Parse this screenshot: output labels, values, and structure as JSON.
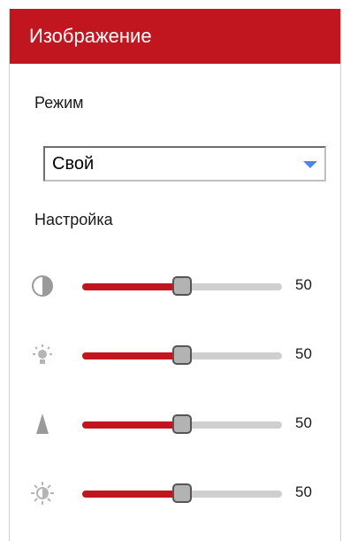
{
  "header": {
    "title": "Изображение"
  },
  "mode": {
    "label": "Режим",
    "selected": "Свой"
  },
  "settings": {
    "label": "Настройка",
    "sliders": [
      {
        "icon": "contrast-icon",
        "value": "50",
        "level": 0.5
      },
      {
        "icon": "brightness-icon",
        "value": "50",
        "level": 0.5
      },
      {
        "icon": "sharpness-icon",
        "value": "50",
        "level": 0.5
      },
      {
        "icon": "saturation-icon",
        "value": "50",
        "level": 0.5
      }
    ]
  },
  "colors": {
    "accent": "#c1161f",
    "track": "#cfcfcf",
    "arrow": "#4a86e8"
  }
}
